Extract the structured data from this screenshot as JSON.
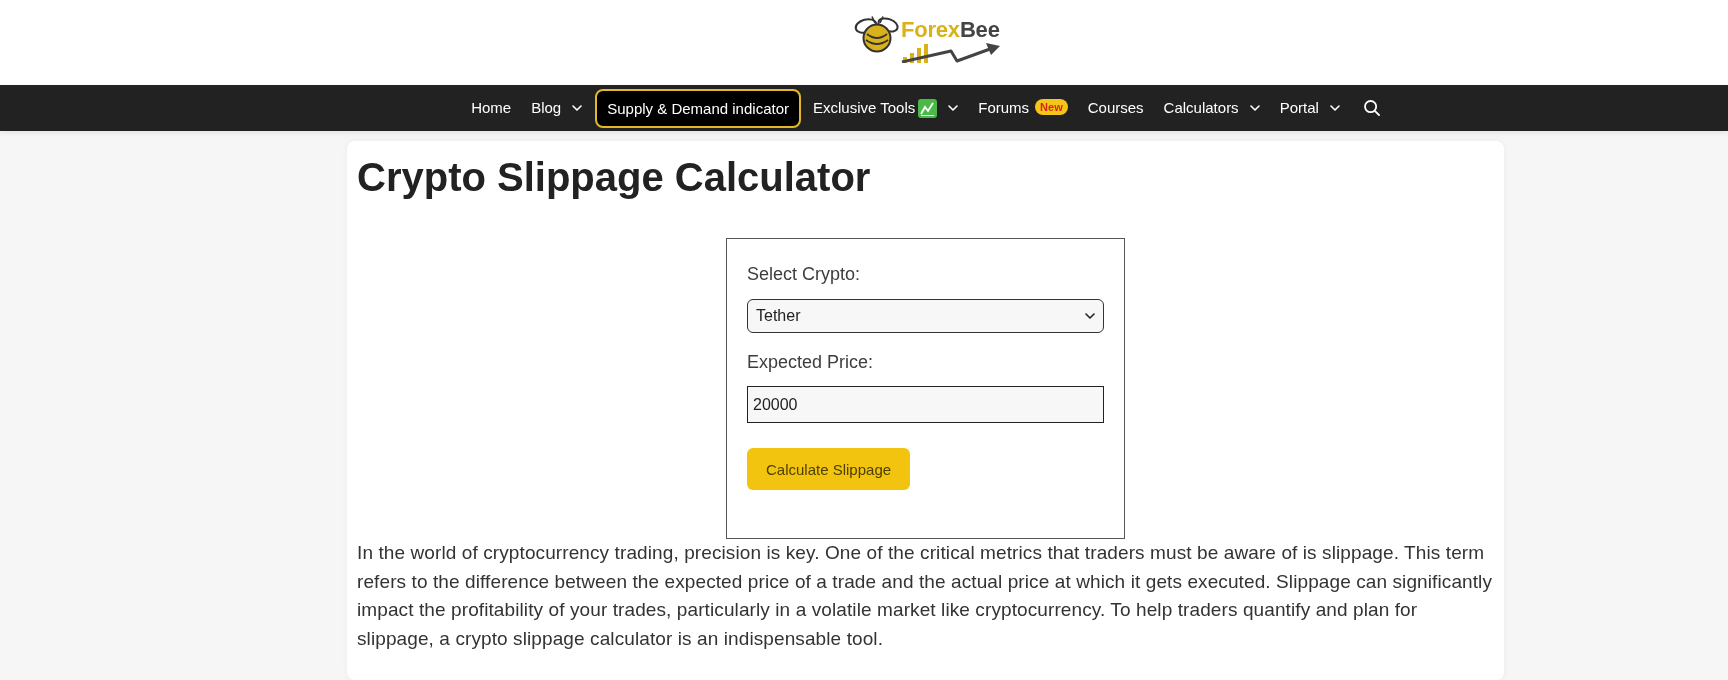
{
  "header": {
    "logo": {
      "parts": [
        {
          "kind": "accent",
          "text": "Forex"
        },
        {
          "kind": "plain",
          "text": "Bee"
        }
      ]
    }
  },
  "nav": {
    "items": [
      {
        "kind": "link",
        "label": "Home",
        "dropdown": false,
        "icon": false
      },
      {
        "kind": "link",
        "label": "Blog",
        "dropdown": true,
        "icon": false
      },
      {
        "kind": "featured",
        "label": "Supply & Demand indicator"
      },
      {
        "kind": "link",
        "label": "Exclusive Tools",
        "dropdown": true,
        "icon": true
      },
      {
        "kind": "link",
        "label": "Forums",
        "dropdown": false,
        "icon": false,
        "badge": "New"
      },
      {
        "kind": "link",
        "label": "Courses",
        "dropdown": false,
        "icon": false
      },
      {
        "kind": "link",
        "label": "Calculators",
        "dropdown": true,
        "icon": false
      },
      {
        "kind": "link",
        "label": "Portal",
        "dropdown": true,
        "icon": false
      },
      {
        "kind": "search"
      }
    ]
  },
  "page": {
    "title": "Crypto Slippage Calculator",
    "calculator": {
      "fields": [
        {
          "kind": "select",
          "label": "Select Crypto:",
          "value": "Tether"
        },
        {
          "kind": "text",
          "label": "Expected Price:",
          "value": "20000"
        }
      ],
      "button": "Calculate Slippage"
    },
    "intro": "In the world of cryptocurrency trading, precision is key. One of the critical metrics that traders must be aware of is slippage. This term refers to the difference between the expected price of a trade and the actual price at which it gets executed. Slippage can significantly impact the profitability of your trades, particularly in a volatile market like cryptocurrency. To help traders quantify and plan for slippage, a crypto slippage calculator is an indispensable tool."
  }
}
